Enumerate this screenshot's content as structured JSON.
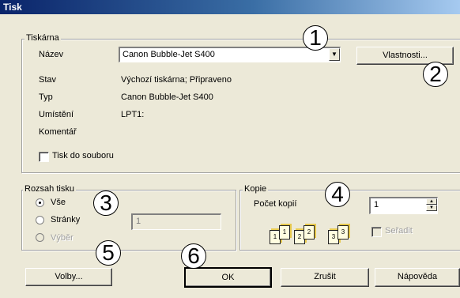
{
  "window": {
    "title": "Tisk"
  },
  "printer": {
    "group_label": "Tiskárna",
    "name_label": "Název",
    "name_value": "Canon Bubble-Jet S400",
    "properties_button": "Vlastnosti...",
    "rows": [
      {
        "label": "Stav",
        "value": "Výchozí tiskárna; Připraveno"
      },
      {
        "label": "Typ",
        "value": "Canon Bubble-Jet S400"
      },
      {
        "label": "Umístění",
        "value": "LPT1:"
      },
      {
        "label": "Komentář",
        "value": ""
      }
    ],
    "print_to_file_label": "Tisk do souboru",
    "print_to_file_checked": false
  },
  "range": {
    "group_label": "Rozsah tisku",
    "all_label": "Vše",
    "pages_label": "Stránky",
    "pages_value": "1",
    "selection_label": "Výběr",
    "selected": "Vše"
  },
  "copies": {
    "group_label": "Kopie",
    "count_label": "Počet kopií",
    "count_value": "1",
    "collate_label": "Seřadit",
    "collate_checked": false,
    "icon_pages": [
      "1",
      "1",
      "2",
      "2",
      "3",
      "3"
    ]
  },
  "buttons": {
    "options": "Volby...",
    "ok": "OK",
    "cancel": "Zrušit",
    "help": "Nápověda"
  },
  "callouts": [
    "1",
    "2",
    "3",
    "4",
    "5",
    "6"
  ]
}
